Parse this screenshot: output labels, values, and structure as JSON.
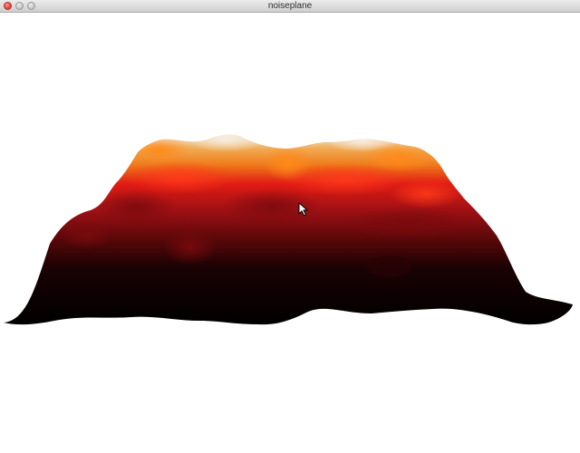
{
  "window": {
    "title": "noiseplane"
  },
  "scene": {
    "background": "#ffffff",
    "palette": {
      "base": "#000000",
      "deep": "#3a0506",
      "mid": "#8e0f12",
      "red": "#e11b14",
      "orange": "#f07a1a",
      "peak": "#f2e6d6"
    }
  },
  "icons": {
    "cursor": "arrow-cursor-icon"
  }
}
